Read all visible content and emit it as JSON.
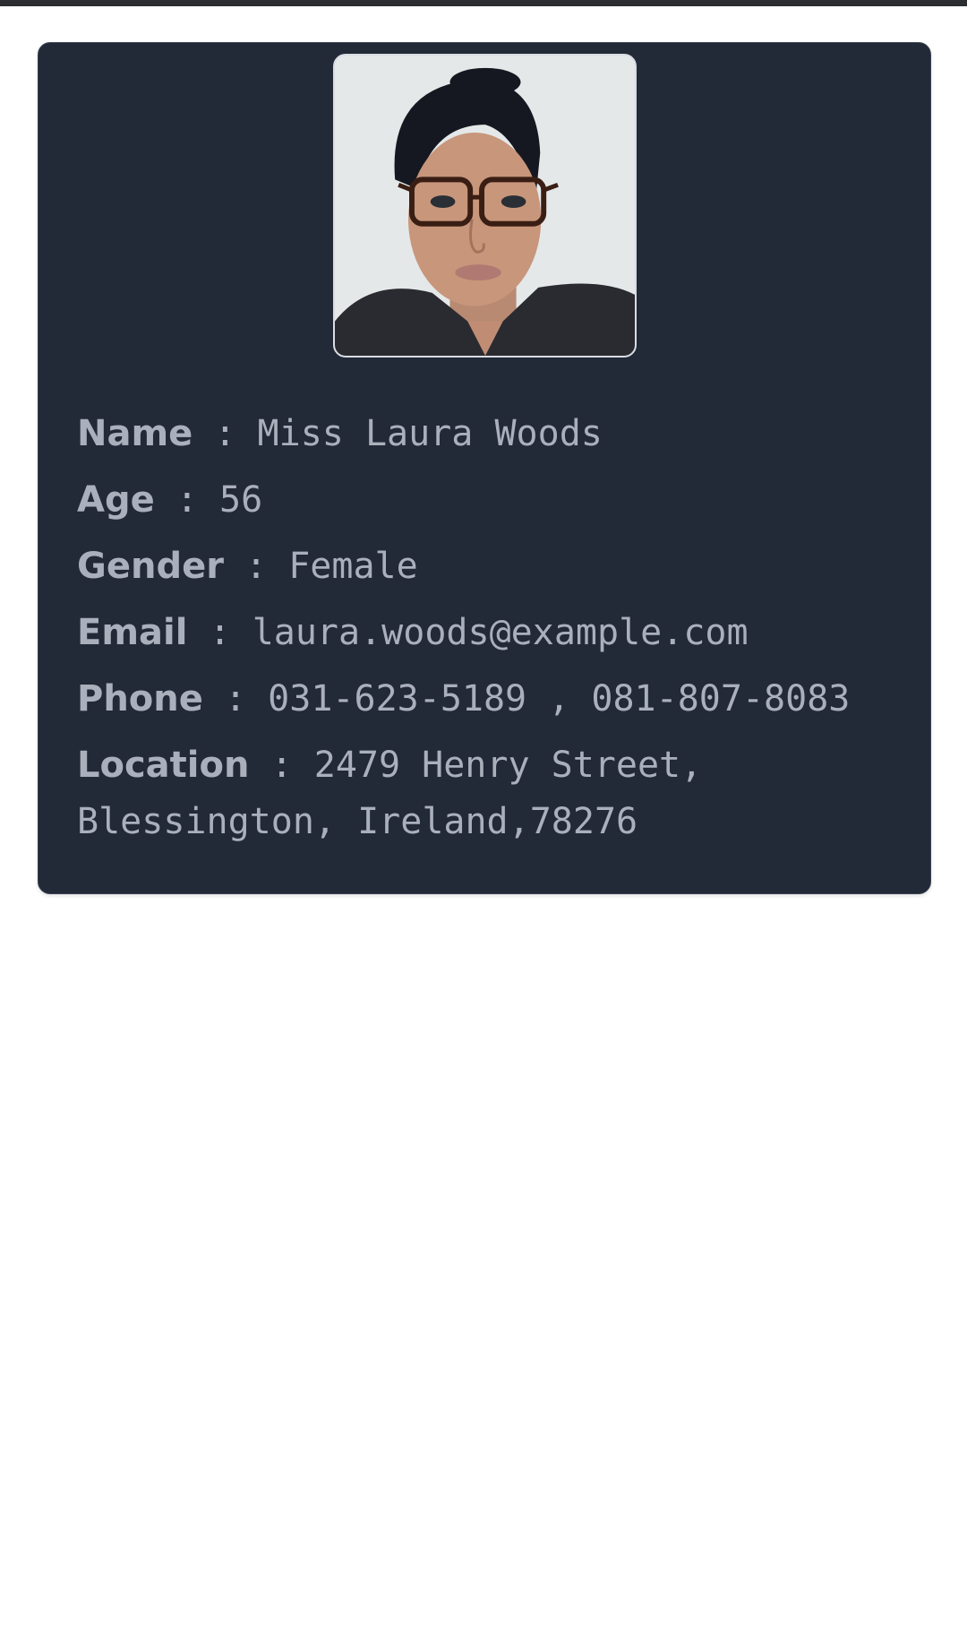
{
  "profile": {
    "photo_alt": "profile photo",
    "fields": {
      "name": {
        "label": "Name",
        "value": "Miss Laura Woods"
      },
      "age": {
        "label": "Age",
        "value": "56"
      },
      "gender": {
        "label": "Gender",
        "value": "Female"
      },
      "email": {
        "label": "Email",
        "value": "laura.woods@example.com"
      },
      "phone": {
        "label": "Phone",
        "value": "031-623-5189 , 081-807-8083"
      },
      "location": {
        "label": "Location",
        "value": "2479 Henry Street, Blessington, Ireland,78276"
      }
    },
    "separator": ":"
  },
  "colors": {
    "page_background": "#ffffff",
    "card_background": "#222937",
    "text": "#aab0bb",
    "top_bar": "#2b2d31"
  }
}
